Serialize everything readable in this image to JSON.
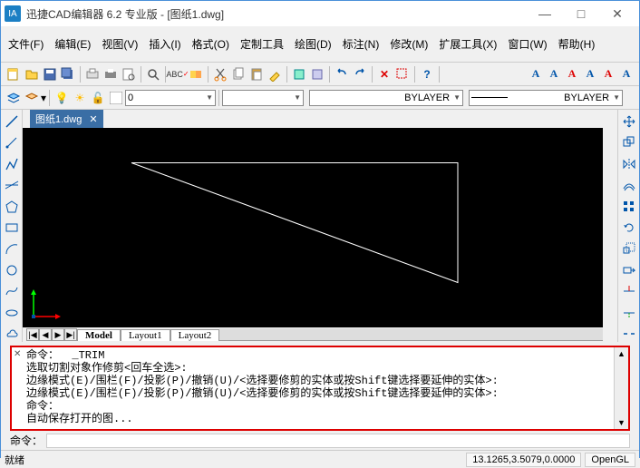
{
  "window": {
    "app_icon_text": "IA",
    "title": "迅捷CAD编辑器 6.2 专业版  - [图纸1.dwg]",
    "min": "—",
    "max": "□",
    "close": "✕"
  },
  "menu": {
    "file": "文件(F)",
    "edit": "编辑(E)",
    "view": "视图(V)",
    "insert": "插入(I)",
    "format": "格式(O)",
    "customtools": "定制工具",
    "draw": "绘图(D)",
    "annotate": "标注(N)",
    "modify": "修改(M)",
    "exttools": "扩展工具(X)",
    "window": "窗口(W)",
    "help": "帮助(H)"
  },
  "toolbar2": {
    "layer_combo": "0",
    "linetype1": "BYLAYER",
    "linetype2": "BYLAYER"
  },
  "doc_tab": {
    "label": "图纸1.dwg",
    "close": "✕"
  },
  "layout_tabs": {
    "nav": [
      "|◀",
      "◀",
      "▶",
      "▶|"
    ],
    "model": "Model",
    "layout1": "Layout1",
    "layout2": "Layout2"
  },
  "command_log": "命令：  _TRIM\n选取切割对象作修剪<回车全选>:\n边缘模式(E)/围栏(F)/投影(P)/撤销(U)/<选择要修剪的实体或按Shift键选择要延伸的实体>:\n边缘模式(E)/围栏(F)/投影(P)/撤销(U)/<选择要修剪的实体或按Shift键选择要延伸的实体>:\n命令：\n自动保存打开的图...",
  "command_prompt": "命令：",
  "status": {
    "ready": "就绪",
    "coords": "13.1265,3.5079,0.0000",
    "mode": "OpenGL"
  },
  "text_style": {
    "A": "A"
  }
}
